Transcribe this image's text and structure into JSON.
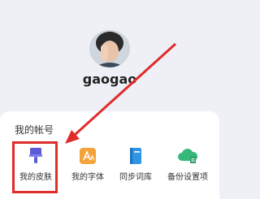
{
  "profile": {
    "username": "gaogao",
    "avatar_icon": "user-photo-avatar"
  },
  "account_section": {
    "title": "我的帐号",
    "items": [
      {
        "label": "我的皮肤",
        "icon": "paint-brush-icon",
        "color": "#5b5bd6"
      },
      {
        "label": "我的字体",
        "icon": "font-icon",
        "color": "#f3a33a"
      },
      {
        "label": "同步词库",
        "icon": "book-icon",
        "color": "#2f95e6"
      },
      {
        "label": "备份设置项",
        "icon": "cloud-backup-icon",
        "color": "#37b87a"
      }
    ]
  },
  "annotation": {
    "color": "#e02b2b"
  }
}
